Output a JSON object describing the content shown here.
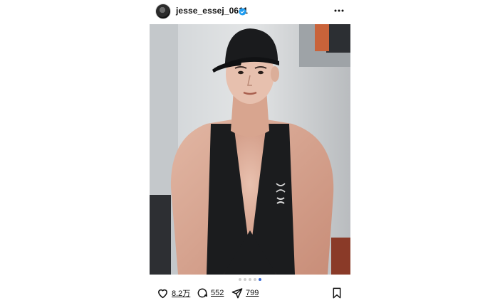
{
  "post": {
    "username": "jesse_essej_0611",
    "verified": true,
    "more_icon": "more-horizontal-icon",
    "image": {
      "carousel_count": 5,
      "active_index": 4,
      "brand_logo": "UA"
    },
    "actions": {
      "like_icon": "heart-icon",
      "likes": "8.2万",
      "comment_icon": "comment-icon",
      "comments": "552",
      "share_icon": "send-icon",
      "shares": "799",
      "save_icon": "bookmark-icon"
    }
  },
  "colors": {
    "accent": "#3a6ad6",
    "verified": "#1d9bf0",
    "text": "#111111"
  }
}
